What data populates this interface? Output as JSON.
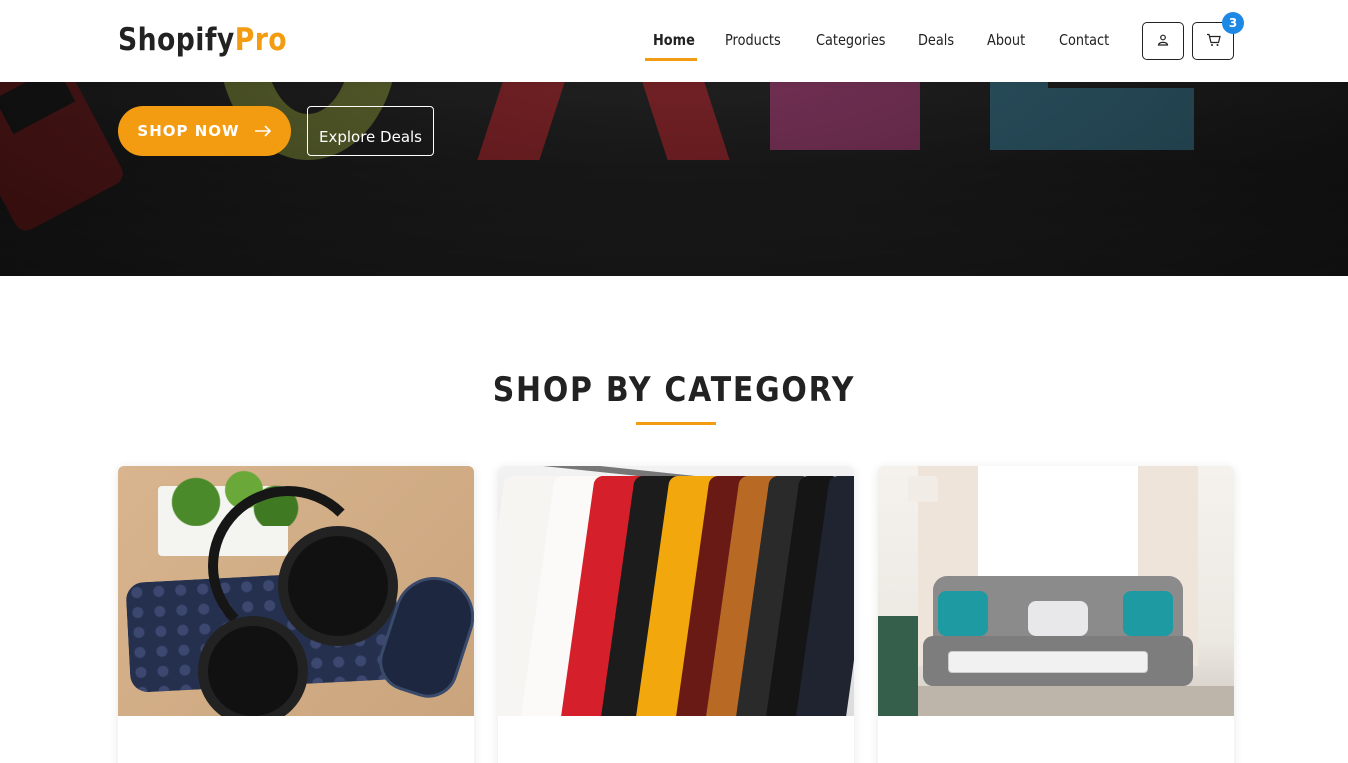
{
  "brand": {
    "name_main": "Shopify",
    "name_accent": "Pro",
    "accent_color": "#f39c12"
  },
  "nav": {
    "items": [
      {
        "label": "Home",
        "active": true
      },
      {
        "label": "Products",
        "active": false
      },
      {
        "label": "Categories",
        "active": false
      },
      {
        "label": "Deals",
        "active": false
      },
      {
        "label": "About",
        "active": false
      },
      {
        "label": "Contact",
        "active": false
      }
    ],
    "icons": {
      "account": "user-icon",
      "cart": "cart-icon"
    },
    "cart_count": "3",
    "badge_color": "#1e88e5"
  },
  "hero": {
    "shop_now_label": "SHOP NOW",
    "explore_label": "Explore Deals"
  },
  "categories": {
    "title": "SHOP BY CATEGORY",
    "cards": [
      {
        "image": "electronics-image"
      },
      {
        "image": "clothing-image"
      },
      {
        "image": "home-living-image"
      }
    ]
  }
}
